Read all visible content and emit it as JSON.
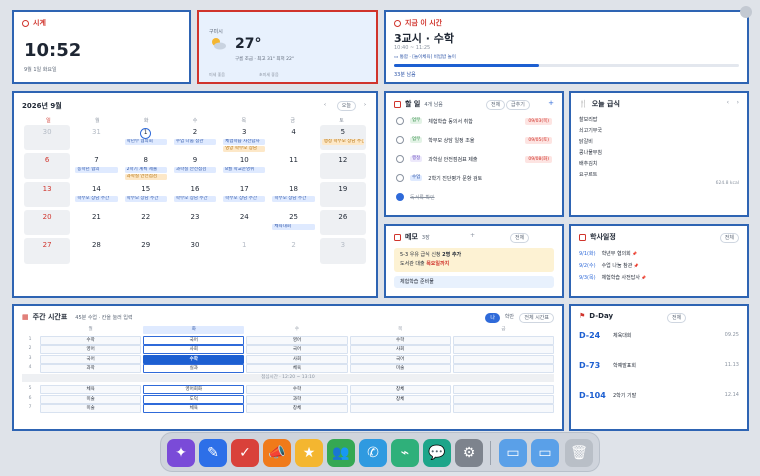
{
  "clock": {
    "title": "시계",
    "time": "10:52",
    "date": "9월 1일 화요일"
  },
  "weather": {
    "location": "구미시",
    "temp": "27°",
    "desc": "구름 조금 · 최고 31° 최저 22°",
    "extra1": "미세 좋음",
    "extra2": "초미세 좋음"
  },
  "now_class": {
    "title": "지금 이 시간",
    "period": "3교시 · 수학",
    "time": "10:40 ~ 11:25",
    "note": "통합 · [놀이체육] 비빔밥 놀이",
    "remain": "33분 남음",
    "progress": 0.42
  },
  "calendar": {
    "title": "2026년 9월",
    "today_btn": "오늘",
    "prev": "‹",
    "next": "›",
    "weekdays": [
      "일",
      "월",
      "화",
      "수",
      "목",
      "금",
      "토"
    ],
    "days": [
      {
        "n": "30",
        "t": "other"
      },
      {
        "n": "31",
        "t": "other"
      },
      {
        "n": "1",
        "t": "today",
        "ev": [
          {
            "c": "b",
            "x": "학년부 협의회"
          }
        ]
      },
      {
        "n": "2",
        "ev": [
          {
            "c": "b",
            "x": "수업 나눔 참관"
          }
        ]
      },
      {
        "n": "3",
        "ev": [
          {
            "c": "b",
            "x": "체험학습 사전답사"
          },
          {
            "c": "o",
            "x": "영양 학부모 상담"
          }
        ]
      },
      {
        "n": "4"
      },
      {
        "n": "5",
        "t": "sat",
        "ev": [
          {
            "c": "o",
            "x": "행정 학부모 상담 주간"
          }
        ]
      },
      {
        "n": "6",
        "t": "sun"
      },
      {
        "n": "7",
        "ev": [
          {
            "c": "b",
            "x": "동학년 협의"
          }
        ]
      },
      {
        "n": "8",
        "ev": [
          {
            "c": "b",
            "x": "2학기 계획 제출"
          },
          {
            "c": "o",
            "x": "과학실 안전점검"
          }
        ]
      },
      {
        "n": "9",
        "ev": [
          {
            "c": "b",
            "x": "과학실 안전점검"
          }
        ]
      },
      {
        "n": "10",
        "ev": [
          {
            "c": "b",
            "x": "8월 학교운영위"
          }
        ]
      },
      {
        "n": "11"
      },
      {
        "n": "12",
        "t": "sat"
      },
      {
        "n": "13",
        "t": "sun"
      },
      {
        "n": "14",
        "ev": [
          {
            "c": "b",
            "x": "학부모 상담 주간"
          }
        ]
      },
      {
        "n": "15",
        "ev": [
          {
            "c": "b",
            "x": "학부모 상담 주간"
          }
        ]
      },
      {
        "n": "16",
        "ev": [
          {
            "c": "b",
            "x": "학부모 상담 주간"
          }
        ]
      },
      {
        "n": "17",
        "ev": [
          {
            "c": "b",
            "x": "학부모 상담 주간"
          }
        ]
      },
      {
        "n": "18",
        "ev": [
          {
            "c": "b",
            "x": "학부모 상담 주간"
          }
        ]
      },
      {
        "n": "19",
        "t": "sat"
      },
      {
        "n": "20",
        "t": "sun"
      },
      {
        "n": "21"
      },
      {
        "n": "22"
      },
      {
        "n": "23"
      },
      {
        "n": "24"
      },
      {
        "n": "25",
        "ev": [
          {
            "c": "b",
            "x": "체육대회"
          }
        ]
      },
      {
        "n": "26",
        "t": "sat"
      },
      {
        "n": "27",
        "t": "sun"
      },
      {
        "n": "28"
      },
      {
        "n": "29"
      },
      {
        "n": "30"
      },
      {
        "n": "1",
        "t": "other"
      },
      {
        "n": "2",
        "t": "other"
      },
      {
        "n": "3",
        "t": "other"
      }
    ]
  },
  "todo": {
    "title": "할 일",
    "count": "4개 남음",
    "b1": "전체",
    "b2": "급추기",
    "items": [
      {
        "tag": "업무",
        "text": "체험학습 동의서 취합",
        "due": "09/03(목)",
        "done": false
      },
      {
        "tag": "업무",
        "text": "학부모 상담 일정 조율",
        "due": "09/05(토)",
        "done": false
      },
      {
        "tag": "행정",
        "text": "과학실 안전점검표 제출",
        "due": "09/08(화)",
        "done": false
      },
      {
        "tag": "수업",
        "text": "2학기 진단평가 문항 검토",
        "due": "",
        "done": false
      },
      {
        "tag": "",
        "text": "독서록 확인",
        "due": "",
        "done": true
      }
    ]
  },
  "meal": {
    "title": "오늘 급식",
    "items": [
      "찰보리밥",
      "쇠고기무국",
      "닭갈비",
      "콩나물무침",
      "배추김치",
      "요구르트"
    ],
    "kcal": "624.8 kcal"
  },
  "memo": {
    "title": "메모",
    "count": "3장",
    "all": "전체",
    "add": "+",
    "note1a": "5-3 우유 급식 신청 ",
    "note1b": "2명 추가",
    "note2a": "도서관 대출 ",
    "note2b": "목요일까지",
    "note3": "체험학습 준비물"
  },
  "schedule": {
    "title": "학사일정",
    "all": "전체",
    "items": [
      {
        "d": "9/1(화)",
        "t": "학년부 협의회"
      },
      {
        "d": "9/2(수)",
        "t": "수업 나눔 참관"
      },
      {
        "d": "9/3(목)",
        "t": "체험학습 사전답사"
      }
    ]
  },
  "timetable": {
    "title": "주간 시간표",
    "sub": "45분 수업 · 칸을 눌러 입력",
    "btn1": "나",
    "btn2": "학반",
    "btn3": "전체 시간표",
    "head": [
      "월",
      "화",
      "수",
      "목",
      "금"
    ],
    "rows": [
      [
        "1",
        "수학",
        "국어",
        "영어",
        "수학",
        ""
      ],
      [
        "2",
        "영어",
        "사회",
        "국어",
        "사회",
        ""
      ],
      [
        "3",
        "국어",
        "수학",
        "사회",
        "국어",
        ""
      ],
      [
        "4",
        "과학",
        "실과",
        "체육",
        "미술",
        ""
      ]
    ],
    "lunch": "점심시간 · 12:20 ~ 13:10",
    "rows2": [
      [
        "5",
        "체육",
        "영어회화",
        "수학",
        "창체",
        ""
      ],
      [
        "6",
        "미술",
        "도덕",
        "과학",
        "창체",
        ""
      ],
      [
        "7",
        "미술",
        "체육",
        "창체",
        "",
        ""
      ]
    ]
  },
  "dday": {
    "title": "D-Day",
    "all": "전체",
    "items": [
      {
        "d": "D-24",
        "t": "체육대회",
        "date": "09.25"
      },
      {
        "d": "D-73",
        "t": "학예발표회",
        "date": "11.13"
      },
      {
        "d": "D-104",
        "t": "2학기 기말",
        "date": "12.14"
      }
    ]
  },
  "dock_icons": [
    "sparkle-icon",
    "pen-icon",
    "clipboard-icon",
    "megaphone-icon",
    "star-icon",
    "people-icon",
    "phone-icon",
    "broom-icon",
    "chat-icon",
    "gear-icon",
    "folder-icon",
    "folder-icon",
    "trash-icon"
  ]
}
